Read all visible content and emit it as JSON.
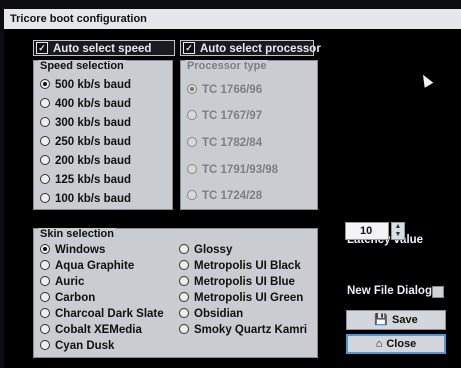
{
  "window": {
    "title": "Tricore boot configuration"
  },
  "auto_select_speed": {
    "label": "Auto select speed",
    "checked": true
  },
  "auto_select_processor": {
    "label": "Auto select processor",
    "checked": true
  },
  "speed_selection": {
    "title": "Speed selection",
    "selected": "500 kb/s baud",
    "options": [
      "500 kb/s baud",
      "400 kb/s baud",
      "300 kb/s baud",
      "250 kb/s baud",
      "200 kb/s baud",
      "125 kb/s baud",
      "100 kb/s baud"
    ]
  },
  "processor_type": {
    "title": "Processor type",
    "selected": "TC 1766/96",
    "options": [
      "TC 1766/96",
      "TC 1767/97",
      "TC 1782/84",
      "TC 1791/93/98",
      "TC 1724/28"
    ]
  },
  "skin_selection": {
    "title": "Skin selection",
    "selected": "Windows",
    "column1": [
      "Windows",
      "Aqua Graphite",
      "Auric",
      "Carbon",
      "Charcoal Dark Slate",
      "Cobalt XEMedia",
      "Cyan Dusk"
    ],
    "column2": [
      "Glossy",
      "Metropolis UI Black",
      "Metropolis UI Blue",
      "Metropolis UI Green",
      "Obsidian",
      "Smoky Quartz Kamri"
    ]
  },
  "latency": {
    "label": "Latency value",
    "value": "10"
  },
  "new_file_dialog": {
    "label": "New File Dialog",
    "checked": false
  },
  "buttons": {
    "save": "Save",
    "close": "Close"
  },
  "icons": [
    "checkbox-check-icon",
    "spin-up-icon",
    "spin-down-icon",
    "floppy-disk-icon",
    "home-icon",
    "mouse-pointer-icon"
  ]
}
